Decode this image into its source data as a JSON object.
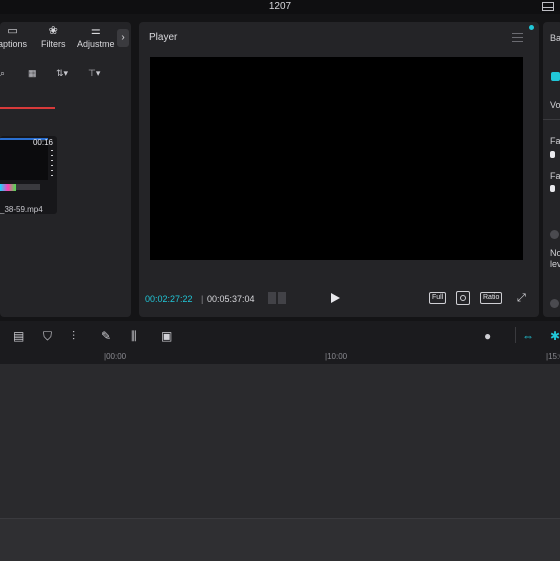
{
  "window": {
    "title": "1207"
  },
  "media_panel": {
    "tabs": [
      {
        "label": "aptions",
        "icon": "captions-icon"
      },
      {
        "label": "Filters",
        "icon": "filters-icon"
      },
      {
        "label": "Adjustme",
        "icon": "adjustment-sliders-icon"
      }
    ],
    "collapse_glyph": "›",
    "toolbar": {
      "search_glyph": "⌕",
      "view_glyph": "▦",
      "sort_glyph": "⇅▾",
      "filter_glyph": "⊤▾"
    },
    "clip": {
      "duration": "00:16",
      "filename": "_38-59.mp4"
    }
  },
  "player": {
    "title": "Player",
    "current_time": "00:02:27:22",
    "separator": "|",
    "total_time": "00:05:37:04",
    "buttons": {
      "full": "Full",
      "ratio": "Ratio"
    }
  },
  "right_panel": {
    "tab_label": "Ba",
    "vo_label": "Vo",
    "fa1_label": "Fa",
    "fa2_label": "Fa",
    "no_label": "No",
    "le_label": "lev"
  },
  "timeline": {
    "ruler_ticks": [
      "|00:00",
      "|10:00",
      "|15:0"
    ]
  },
  "colors": {
    "accent": "#21c7d8",
    "panel_bg": "#242427",
    "app_bg": "#141416",
    "record_red": "#d83a3a"
  }
}
